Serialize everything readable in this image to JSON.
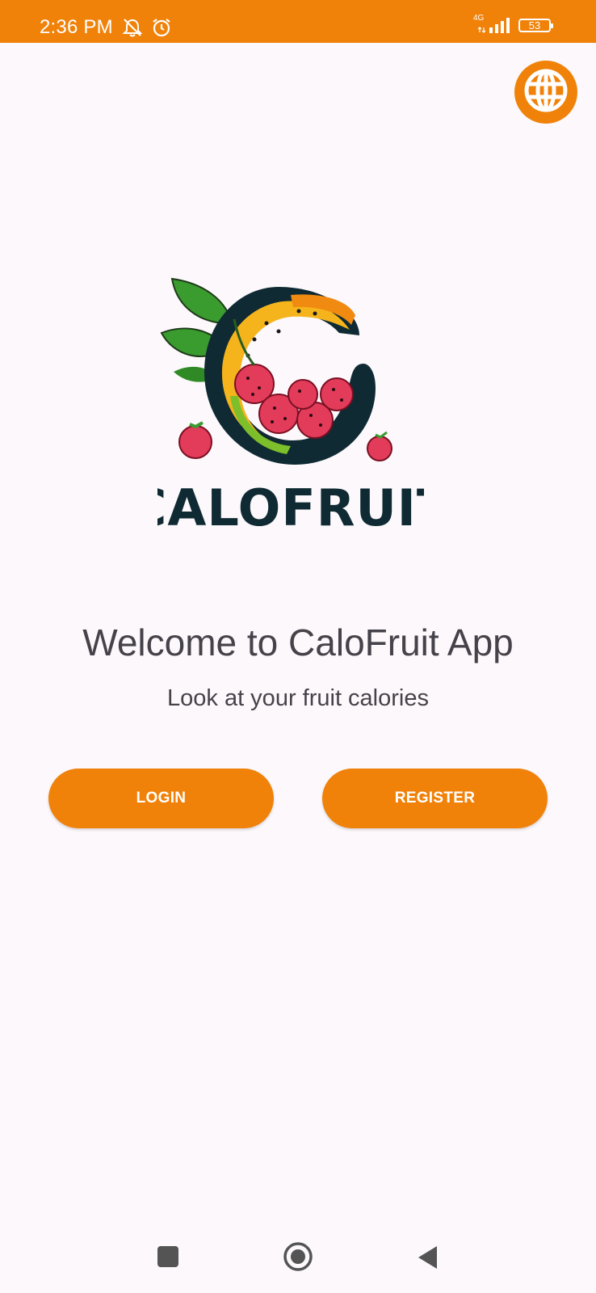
{
  "status_bar": {
    "time": "2:36 PM",
    "network": "4G",
    "battery": "53",
    "icons": [
      "notifications-off-icon",
      "alarm-icon",
      "signal-icon",
      "battery-icon"
    ]
  },
  "header": {
    "language_icon": "globe-icon"
  },
  "logo": {
    "text": "CALOFRUIT"
  },
  "main": {
    "title": "Welcome to CaloFruit App",
    "subtitle": "Look at your fruit calories",
    "login_label": "LOGIN",
    "register_label": "REGISTER"
  },
  "nav_bar": {
    "icons": [
      "recents-icon",
      "home-icon",
      "back-icon"
    ]
  },
  "colors": {
    "accent": "#f0820a",
    "background": "#fcf8fb",
    "text": "#46424a"
  }
}
